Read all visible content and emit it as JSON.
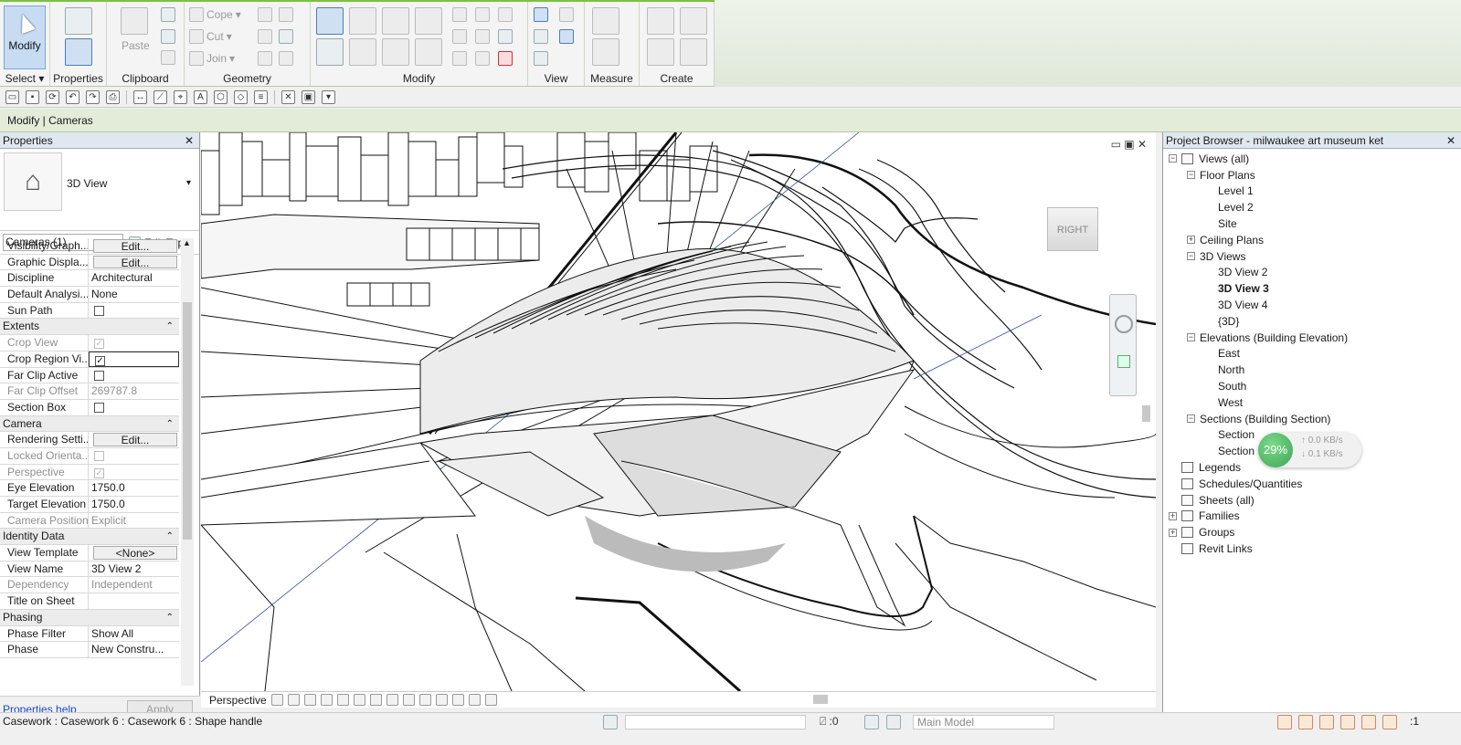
{
  "ribbon": {
    "panels": {
      "select": "Select",
      "properties": "Properties",
      "clipboard": "Clipboard",
      "geometry": "Geometry",
      "modify": "Modify",
      "view": "View",
      "measure": "Measure",
      "create": "Create"
    },
    "modify_button": "Modify",
    "paste": "Paste",
    "cope": "Cope",
    "cut": "Cut",
    "join": "Join"
  },
  "contextbar": {
    "title": "Modify | Cameras"
  },
  "properties": {
    "title": "Properties",
    "close": "✕",
    "type_name": "3D View",
    "filter": "Cameras (1)",
    "edit_type": "Edit Type",
    "rows": [
      {
        "name": "Visibility/Graph...",
        "value": "Edit...",
        "kind": "button"
      },
      {
        "name": "Graphic Displa...",
        "value": "Edit...",
        "kind": "button"
      },
      {
        "name": "Discipline",
        "value": "Architectural",
        "kind": "text"
      },
      {
        "name": "Default Analysi...",
        "value": "None",
        "kind": "text"
      },
      {
        "name": "Sun Path",
        "value": "",
        "kind": "check"
      },
      {
        "name": "Extents",
        "value": "",
        "kind": "group"
      },
      {
        "name": "Crop View",
        "value": "✓",
        "kind": "check-dim"
      },
      {
        "name": "Crop Region Vi...",
        "value": "✓",
        "kind": "check-sel"
      },
      {
        "name": "Far Clip Active",
        "value": "",
        "kind": "check"
      },
      {
        "name": "Far Clip Offset",
        "value": "269787.8",
        "kind": "text-dim"
      },
      {
        "name": "Section Box",
        "value": "",
        "kind": "check"
      },
      {
        "name": "Camera",
        "value": "",
        "kind": "group"
      },
      {
        "name": "Rendering Setti...",
        "value": "Edit...",
        "kind": "button"
      },
      {
        "name": "Locked Orienta...",
        "value": "",
        "kind": "check-dim"
      },
      {
        "name": "Perspective",
        "value": "✓",
        "kind": "check-dim"
      },
      {
        "name": "Eye Elevation",
        "value": "1750.0",
        "kind": "text"
      },
      {
        "name": "Target Elevation",
        "value": "1750.0",
        "kind": "text"
      },
      {
        "name": "Camera Position",
        "value": "Explicit",
        "kind": "text-dim"
      },
      {
        "name": "Identity Data",
        "value": "",
        "kind": "group"
      },
      {
        "name": "View Template",
        "value": "<None>",
        "kind": "button"
      },
      {
        "name": "View Name",
        "value": "3D View 2",
        "kind": "text"
      },
      {
        "name": "Dependency",
        "value": "Independent",
        "kind": "text-dim"
      },
      {
        "name": "Title on Sheet",
        "value": "",
        "kind": "text"
      },
      {
        "name": "Phasing",
        "value": "",
        "kind": "group"
      },
      {
        "name": "Phase Filter",
        "value": "Show All",
        "kind": "text"
      },
      {
        "name": "Phase",
        "value": "New Constru...",
        "kind": "text"
      }
    ],
    "help_link": "Properties help",
    "apply": "Apply"
  },
  "viewport": {
    "viewcube_label": "RIGHT",
    "viewbar_mode": "Perspective"
  },
  "browser": {
    "title": "Project Browser - milwaukee art museum ket",
    "close": "✕",
    "tree": [
      {
        "label": "Views (all)",
        "level": 0,
        "toggle": "−",
        "icon": true,
        "bold": false
      },
      {
        "label": "Floor Plans",
        "level": 1,
        "toggle": "−",
        "icon": false,
        "bold": false
      },
      {
        "label": "Level 1",
        "level": 2,
        "toggle": "",
        "icon": false,
        "bold": false
      },
      {
        "label": "Level 2",
        "level": 2,
        "toggle": "",
        "icon": false,
        "bold": false
      },
      {
        "label": "Site",
        "level": 2,
        "toggle": "",
        "icon": false,
        "bold": false
      },
      {
        "label": "Ceiling Plans",
        "level": 1,
        "toggle": "+",
        "icon": false,
        "bold": false
      },
      {
        "label": "3D Views",
        "level": 1,
        "toggle": "−",
        "icon": false,
        "bold": false
      },
      {
        "label": "3D View 2",
        "level": 2,
        "toggle": "",
        "icon": false,
        "bold": false
      },
      {
        "label": "3D View 3",
        "level": 2,
        "toggle": "",
        "icon": false,
        "bold": true
      },
      {
        "label": "3D View 4",
        "level": 2,
        "toggle": "",
        "icon": false,
        "bold": false
      },
      {
        "label": "{3D}",
        "level": 2,
        "toggle": "",
        "icon": false,
        "bold": false
      },
      {
        "label": "Elevations (Building Elevation)",
        "level": 1,
        "toggle": "−",
        "icon": false,
        "bold": false
      },
      {
        "label": "East",
        "level": 2,
        "toggle": "",
        "icon": false,
        "bold": false
      },
      {
        "label": "North",
        "level": 2,
        "toggle": "",
        "icon": false,
        "bold": false
      },
      {
        "label": "South",
        "level": 2,
        "toggle": "",
        "icon": false,
        "bold": false
      },
      {
        "label": "West",
        "level": 2,
        "toggle": "",
        "icon": false,
        "bold": false
      },
      {
        "label": "Sections (Building Section)",
        "level": 1,
        "toggle": "−",
        "icon": false,
        "bold": false
      },
      {
        "label": "Section",
        "level": 2,
        "toggle": "",
        "icon": false,
        "bold": false
      },
      {
        "label": "Section",
        "level": 2,
        "toggle": "",
        "icon": false,
        "bold": false
      },
      {
        "label": "Legends",
        "level": 0,
        "toggle": "",
        "icon": true,
        "bold": false
      },
      {
        "label": "Schedules/Quantities",
        "level": 0,
        "toggle": "",
        "icon": true,
        "bold": false
      },
      {
        "label": "Sheets (all)",
        "level": 0,
        "toggle": "",
        "icon": true,
        "bold": false
      },
      {
        "label": "Families",
        "level": 0,
        "toggle": "+",
        "icon": true,
        "bold": false
      },
      {
        "label": "Groups",
        "level": 0,
        "toggle": "+",
        "icon": true,
        "bold": false
      },
      {
        "label": "Revit Links",
        "level": 0,
        "toggle": "",
        "icon": true,
        "bold": false
      }
    ]
  },
  "network_badge": {
    "percent": "29%",
    "up": "0.0 KB/s",
    "down": "0.1 KB/s",
    "accent": "#3aa753"
  },
  "statusbar": {
    "text": "Casework : Casework 6 : Casework 6 : Shape handle",
    "filter_count": ":0",
    "model": "Main Model",
    "selection_count": ":1"
  }
}
